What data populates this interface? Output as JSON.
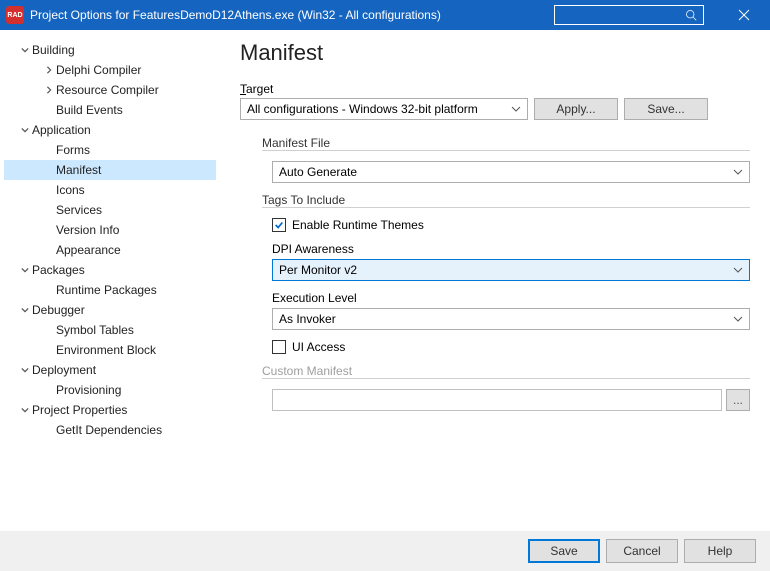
{
  "titlebar": {
    "icon_label": "RAD",
    "title": "Project Options for FeaturesDemoD12Athens.exe  (Win32 - All configurations)"
  },
  "tree": {
    "building": "Building",
    "delphi_compiler": "Delphi Compiler",
    "resource_compiler": "Resource Compiler",
    "build_events": "Build Events",
    "application": "Application",
    "forms": "Forms",
    "manifest": "Manifest",
    "icons": "Icons",
    "services": "Services",
    "version_info": "Version Info",
    "appearance": "Appearance",
    "packages": "Packages",
    "runtime_packages": "Runtime Packages",
    "debugger": "Debugger",
    "symbol_tables": "Symbol Tables",
    "environment_block": "Environment Block",
    "deployment": "Deployment",
    "provisioning": "Provisioning",
    "project_properties": "Project Properties",
    "getit_dependencies": "GetIt Dependencies"
  },
  "page": {
    "title": "Manifest",
    "target_label_pre": "T",
    "target_label_post": "arget",
    "target_value": "All configurations - Windows 32-bit platform",
    "apply": "Apply...",
    "save_as": "Save...",
    "manifest_file_label": "Manifest File",
    "manifest_file_value": "Auto Generate",
    "tags_label": "Tags To Include",
    "enable_themes": "Enable Runtime Themes",
    "dpi_label": "DPI Awareness",
    "dpi_value": "Per Monitor v2",
    "exec_label": "Execution Level",
    "exec_value": "As Invoker",
    "ui_access": "UI Access",
    "custom_label": "Custom Manifest",
    "browse": "..."
  },
  "footer": {
    "save": "Save",
    "cancel": "Cancel",
    "help": "Help"
  }
}
